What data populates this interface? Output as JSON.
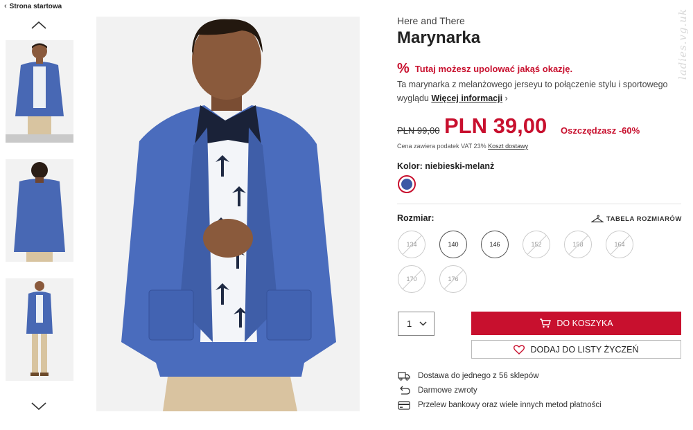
{
  "nav": {
    "back_label": "Strona startowa"
  },
  "product": {
    "brand": "Here and There",
    "title": "Marynarka",
    "deal_text": "Tutaj możesz upolować jakąś okazję.",
    "description": "Ta marynarka z melanżowego jerseyu to połączenie stylu i sportowego wyglądu",
    "more_info": "Więcej informacji",
    "old_price": "PLN 99,00",
    "price": "PLN 39,00",
    "savings": "Oszczędzasz -60%",
    "vat_text": "Cena zawiera podatek VAT 23%",
    "shipping_link": "Koszt dostawy",
    "color_label": "Kolor: niebieski-melanż",
    "color_hex": "#3b5aa6",
    "size_label": "Rozmiar:",
    "size_table_label": "TABELA ROZMIARÓW",
    "sizes": [
      {
        "label": "134",
        "available": false
      },
      {
        "label": "140",
        "available": true
      },
      {
        "label": "146",
        "available": true
      },
      {
        "label": "152",
        "available": false
      },
      {
        "label": "158",
        "available": false
      },
      {
        "label": "164",
        "available": false
      },
      {
        "label": "170",
        "available": false
      },
      {
        "label": "176",
        "available": false
      }
    ],
    "quantity": "1",
    "add_to_cart": "DO KOSZYKA",
    "add_to_wishlist": "DODAJ DO LISTY ŻYCZEŃ"
  },
  "features": [
    {
      "icon": "truck-icon",
      "text": "Dostawa do jednego z 56 sklepów"
    },
    {
      "icon": "return-icon",
      "text": "Darmowe zwroty"
    },
    {
      "icon": "card-icon",
      "text": "Przelew bankowy oraz wiele innych metod płatności"
    }
  ],
  "watermark": "ladies.vg.uk",
  "colors": {
    "accent": "#c8102e",
    "jacket": "#3b5aa6"
  }
}
